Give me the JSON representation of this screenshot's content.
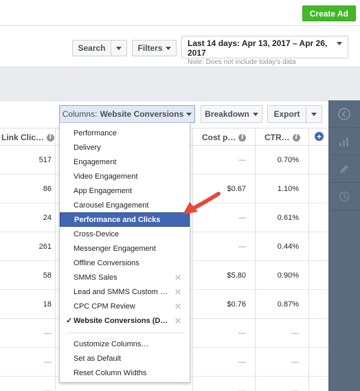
{
  "header": {
    "create_ad": "Create Ad"
  },
  "toolbar": {
    "search_label": "Search",
    "filters_label": "Filters",
    "date_range": "Last 14 days: Apr 13, 2017 – Apr 26, 2017",
    "date_note": "Note: Does not include today's data"
  },
  "table_toolbar": {
    "columns_prefix": "Columns:",
    "columns_value": "Website Conversions",
    "breakdown_label": "Breakdown",
    "export_label": "Export"
  },
  "columns": {
    "link_clicks": "Link Clic…",
    "cost_per": "Cost p…",
    "ctr": "CTR…"
  },
  "rows": [
    {
      "link_clicks": "517",
      "cost_per": "—",
      "ctr": "0.70%"
    },
    {
      "link_clicks": "86",
      "cost_per": "$0.67",
      "ctr": "1.10%"
    },
    {
      "link_clicks": "24",
      "cost_per": "—",
      "ctr": "0.61%"
    },
    {
      "link_clicks": "261",
      "cost_per": "—",
      "ctr": "0.44%"
    },
    {
      "link_clicks": "58",
      "cost_per": "$5.80",
      "ctr": "0.90%"
    },
    {
      "link_clicks": "18",
      "cost_per": "$0.76",
      "ctr": "0.87%"
    },
    {
      "link_clicks": "—",
      "cost_per": "—",
      "ctr": "—"
    },
    {
      "link_clicks": "—",
      "cost_per": "—",
      "ctr": "—"
    },
    {
      "link_clicks": "—",
      "cost_per": "—",
      "ctr": "—"
    }
  ],
  "dropdown": {
    "items": [
      {
        "label": "Performance"
      },
      {
        "label": "Delivery"
      },
      {
        "label": "Engagement"
      },
      {
        "label": "Video Engagement"
      },
      {
        "label": "App Engagement"
      },
      {
        "label": "Carousel Engagement"
      },
      {
        "label": "Performance and Clicks",
        "highlighted": true
      },
      {
        "label": "Cross-Device"
      },
      {
        "label": "Messenger Engagement"
      },
      {
        "label": "Offline Conversions"
      },
      {
        "label": "SMMS Sales",
        "removable": true
      },
      {
        "label": "Lead and SMMS Custom …",
        "removable": true
      },
      {
        "label": "CPC CPM Review",
        "removable": true
      },
      {
        "label": "Website Conversions (D…",
        "removable": true,
        "checked": true
      }
    ],
    "actions": [
      {
        "label": "Customize Columns…"
      },
      {
        "label": "Set as Default"
      },
      {
        "label": "Reset Column Widths"
      }
    ]
  },
  "icons": {
    "remove": "✕",
    "check": "✓",
    "info": "i",
    "add": "+"
  },
  "colors": {
    "create_green": "#42b72a",
    "highlight_blue": "#4267b2",
    "sidebar": "#5b6b7e",
    "arrow_red": "#e8483b"
  }
}
